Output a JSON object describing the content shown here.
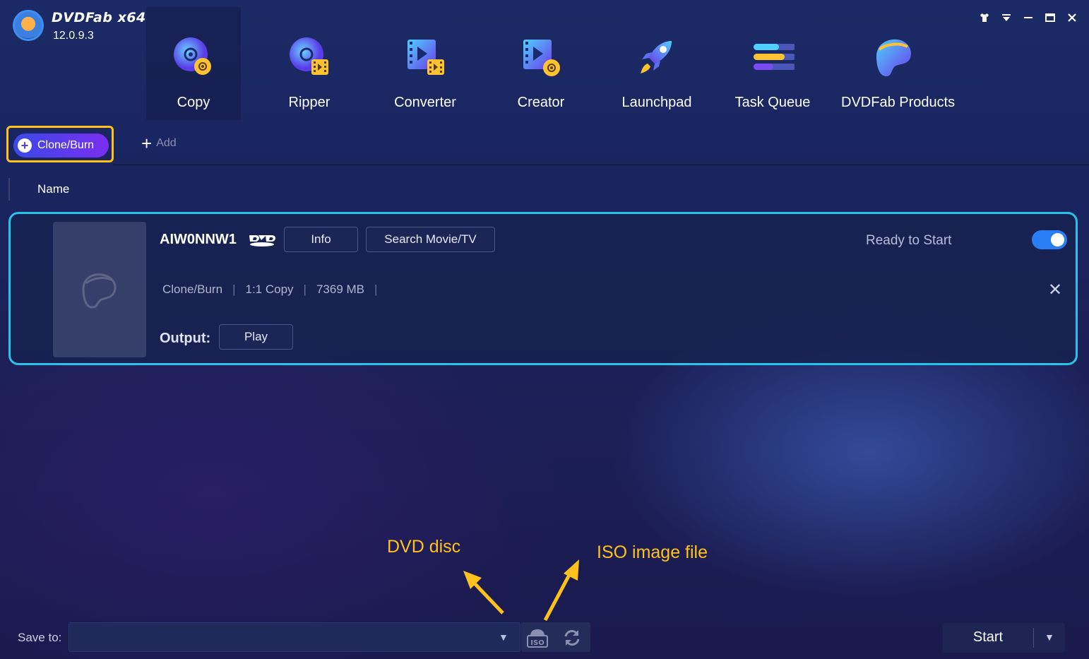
{
  "app": {
    "brand": "DVDFab x64",
    "version": "12.0.9.3"
  },
  "window_controls": [
    "shirt-icon",
    "menu-down-icon",
    "minimize-icon",
    "maximize-icon",
    "close-icon"
  ],
  "nav": {
    "items": [
      {
        "label": "Copy",
        "icon": "disc-copy-icon",
        "active": true
      },
      {
        "label": "Ripper",
        "icon": "disc-ripper-icon"
      },
      {
        "label": "Converter",
        "icon": "video-converter-icon"
      },
      {
        "label": "Creator",
        "icon": "video-creator-icon"
      },
      {
        "label": "Launchpad",
        "icon": "rocket-icon"
      },
      {
        "label": "Task Queue",
        "icon": "task-queue-icon"
      },
      {
        "label": "DVDFab Products",
        "icon": "dvdfab-products-icon"
      }
    ]
  },
  "toolbar": {
    "mode_label": "Clone/Burn",
    "add_label": "Add"
  },
  "list": {
    "header_name": "Name"
  },
  "task": {
    "title": "AIW0NNW1",
    "info_label": "Info",
    "search_label": "Search Movie/TV",
    "status": "Ready to Start",
    "enabled": true,
    "meta": [
      "Clone/Burn",
      "1:1 Copy",
      "7369 MB"
    ],
    "output_label": "Output:",
    "play_label": "Play"
  },
  "annotations": {
    "dvd_disc": "DVD disc",
    "iso_image": "ISO image file",
    "color": "#ffc21a"
  },
  "bottom": {
    "save_to_label": "Save to:",
    "save_to_value": "",
    "start_label": "Start"
  },
  "colors": {
    "accent_border": "#27c4ea",
    "highlight": "#ffc21a",
    "toggle": "#2a7ef5"
  }
}
